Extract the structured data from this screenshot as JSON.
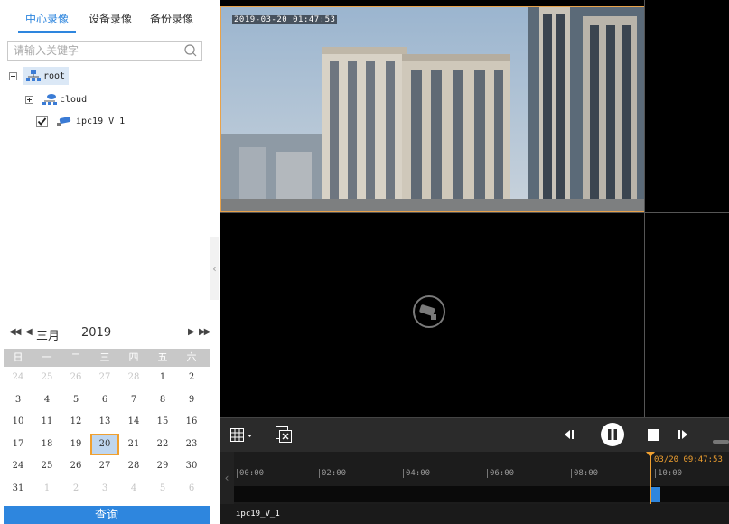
{
  "tabs": [
    {
      "label": "中心录像",
      "active": true
    },
    {
      "label": "设备录像",
      "active": false
    },
    {
      "label": "备份录像",
      "active": false
    }
  ],
  "search": {
    "placeholder": "请输入关键字"
  },
  "tree": {
    "root": {
      "label": "root",
      "expanded": true,
      "selected": true
    },
    "cloud": {
      "label": "cloud",
      "expanded": false
    },
    "camera": {
      "label": "ipc19_V_1",
      "checked": true
    }
  },
  "calendar": {
    "month": "三月",
    "year": "2019",
    "weekdays": [
      "日",
      "一",
      "二",
      "三",
      "四",
      "五",
      "六"
    ],
    "days": [
      [
        "24",
        "25",
        "26",
        "27",
        "28",
        "1",
        "2"
      ],
      [
        "3",
        "4",
        "5",
        "6",
        "7",
        "8",
        "9"
      ],
      [
        "10",
        "11",
        "12",
        "13",
        "14",
        "15",
        "16"
      ],
      [
        "17",
        "18",
        "19",
        "20",
        "21",
        "22",
        "23"
      ],
      [
        "24",
        "25",
        "26",
        "27",
        "28",
        "29",
        "30"
      ],
      [
        "31",
        "1",
        "2",
        "3",
        "4",
        "5",
        "6"
      ]
    ],
    "selected_day": "20"
  },
  "query_label": "查询",
  "video": {
    "osd_timestamp": "2019-03-20 01:47:53"
  },
  "timeline": {
    "ticks": [
      "00:00",
      "02:00",
      "04:00",
      "06:00",
      "08:00",
      "10:00"
    ],
    "cursor_time": "03/20 09:47:53"
  },
  "status": {
    "channel": "ipc19_V_1"
  },
  "colors": {
    "accent": "#2e86de",
    "highlight": "#f0a030",
    "tree_selected": "#dbe8f6"
  }
}
